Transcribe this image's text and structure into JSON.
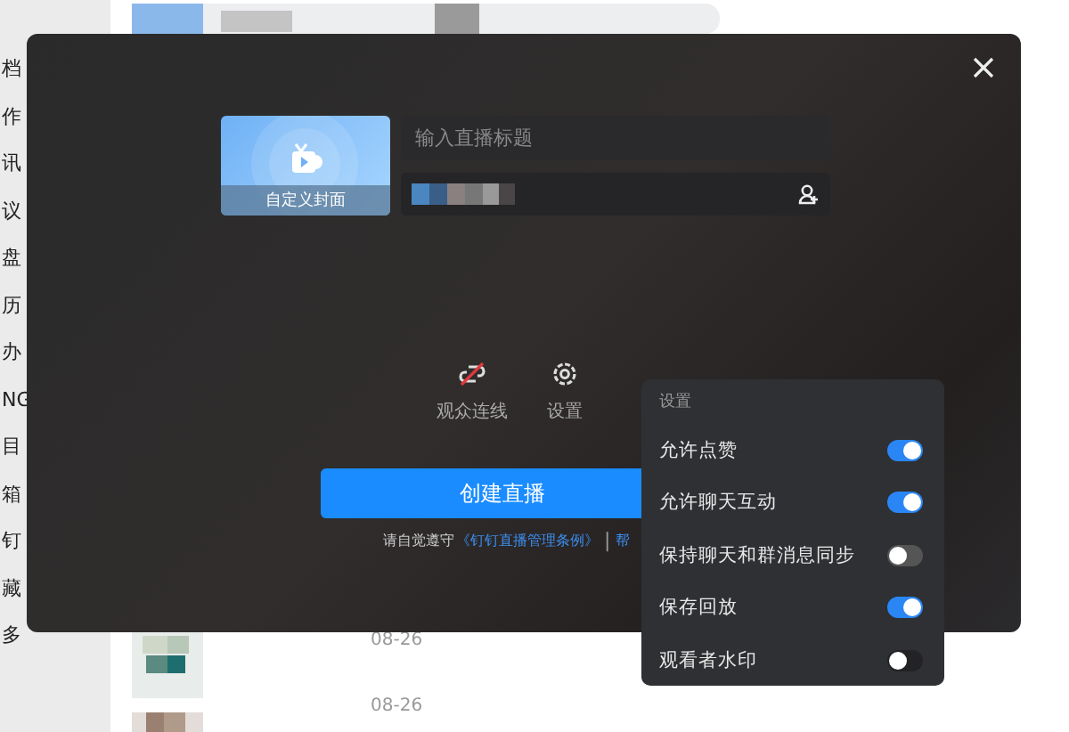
{
  "sidebar": {
    "items": [
      "档",
      "作",
      "讯",
      "议",
      "盘",
      "历",
      "办",
      "NG",
      "目",
      "箱",
      "钉",
      "藏",
      "多"
    ]
  },
  "list": {
    "dates": [
      "08-26",
      "08-26"
    ]
  },
  "dialog": {
    "cover_label": "自定义封面",
    "title_field": {
      "placeholder": "输入直播标题"
    },
    "tools": [
      {
        "kind": "link-off",
        "label": "观众连线"
      },
      {
        "kind": "gear",
        "label": "设置"
      }
    ],
    "create_button": "创建直播",
    "notice": {
      "text": "请自觉遵守",
      "link": "《钉钉直播管理条例》",
      "separator": "|",
      "help": "帮"
    }
  },
  "settings_popup": {
    "title": "设置",
    "options": [
      {
        "label": "允许点赞",
        "on": true
      },
      {
        "label": "允许聊天互动",
        "on": true
      },
      {
        "label": "保持聊天和群消息同步",
        "on": false
      },
      {
        "label": "保存回放",
        "on": true
      },
      {
        "label": "观看者水印",
        "on": false
      }
    ]
  }
}
